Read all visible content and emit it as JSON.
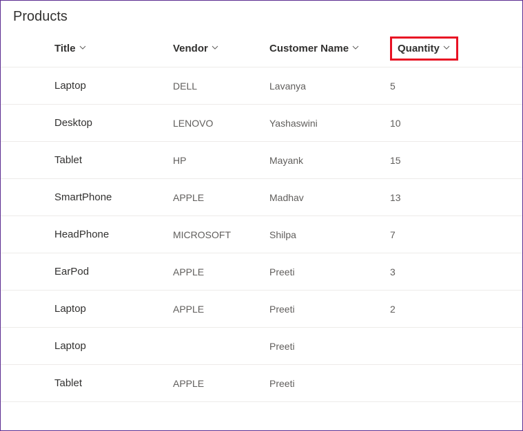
{
  "page": {
    "title": "Products"
  },
  "columns": {
    "title": "Title",
    "vendor": "Vendor",
    "customer": "Customer Name",
    "quantity": "Quantity"
  },
  "rows": [
    {
      "title": "Laptop",
      "vendor": "DELL",
      "customer": "Lavanya",
      "quantity": "5"
    },
    {
      "title": "Desktop",
      "vendor": "LENOVO",
      "customer": "Yashaswini",
      "quantity": "10"
    },
    {
      "title": "Tablet",
      "vendor": "HP",
      "customer": "Mayank",
      "quantity": "15"
    },
    {
      "title": "SmartPhone",
      "vendor": "APPLE",
      "customer": "Madhav",
      "quantity": "13"
    },
    {
      "title": "HeadPhone",
      "vendor": "MICROSOFT",
      "customer": "Shilpa",
      "quantity": "7"
    },
    {
      "title": "EarPod",
      "vendor": "APPLE",
      "customer": "Preeti",
      "quantity": "3"
    },
    {
      "title": "Laptop",
      "vendor": "APPLE",
      "customer": "Preeti",
      "quantity": "2"
    },
    {
      "title": "Laptop",
      "vendor": "",
      "customer": "Preeti",
      "quantity": ""
    },
    {
      "title": "Tablet",
      "vendor": "APPLE",
      "customer": "Preeti",
      "quantity": ""
    }
  ]
}
